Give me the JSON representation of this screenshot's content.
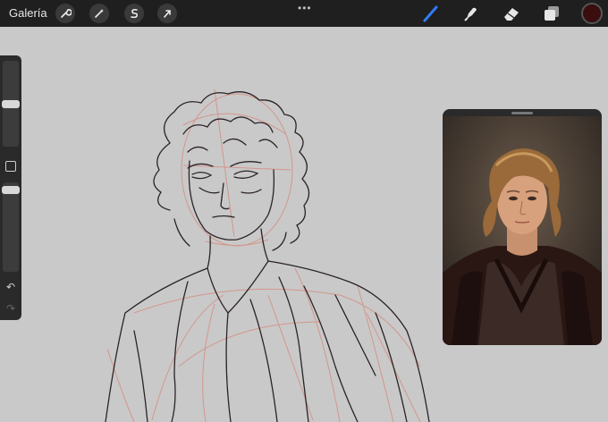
{
  "topbar": {
    "gallery_label": "Galería",
    "left_tools": [
      {
        "icon": "wrench-icon",
        "name": "actions"
      },
      {
        "icon": "magic-wand-icon",
        "name": "adjustments"
      },
      {
        "icon": "selection-icon",
        "name": "selection"
      },
      {
        "icon": "arrow-cursor-icon",
        "name": "transform"
      }
    ],
    "more_dots": "•••",
    "right_tools": [
      {
        "icon": "brush-icon",
        "name": "paint",
        "active": true
      },
      {
        "icon": "smudge-icon",
        "name": "smudge"
      },
      {
        "icon": "eraser-icon",
        "name": "erase"
      },
      {
        "icon": "layers-icon",
        "name": "layers"
      }
    ],
    "current_color": "#3a0e0e",
    "accent_color": "#2f7df6"
  },
  "sidebar": {
    "brush_size_level": 0.35,
    "opacity_level": 0.1,
    "undo_icon": "undo-icon",
    "redo_icon": "redo-icon"
  },
  "reference": {
    "icon": "reference-window"
  },
  "colors": {
    "canvas": "#c9c9c9",
    "toolbar": "#1f1f1f",
    "sketch_dark": "#2b2326",
    "sketch_red": "#d49186"
  }
}
